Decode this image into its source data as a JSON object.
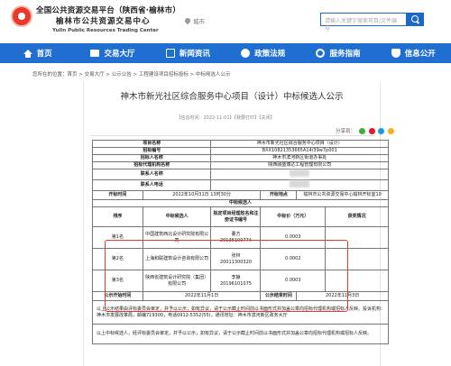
{
  "header": {
    "title_line1": "全国公共资源交易平台（陕西省·榆林市）",
    "title_line2": "榆林市公共资源交易中心",
    "title_en": "Yulin Public Resources Trading Center",
    "location": "城市",
    "search_placeholder": "请输入关键字搜索项目/文件编号"
  },
  "nav": {
    "items": [
      {
        "label": "首页",
        "icon": "home-icon"
      },
      {
        "label": "交易大厅",
        "icon": "trade-hall-icon"
      },
      {
        "label": "新闻资讯",
        "icon": "news-icon"
      },
      {
        "label": "政策法规",
        "icon": "policy-icon"
      },
      {
        "label": "服务指南",
        "icon": "service-icon"
      },
      {
        "label": "信息公开",
        "icon": "info-icon"
      }
    ]
  },
  "breadcrumb": "您所在的位置：首页 > 交易大厅 > 公示公告 > 工程建设项目招标投标 > 中标候选人公示",
  "doc": {
    "title": "神木市新光社区综合服务中心项目（设计）中标候选人公示",
    "meta": "【信息时间：2022-11-01】【我要打印】【关闭】",
    "share_label": "分享到：",
    "share_colors": [
      "#3cb035",
      "#e6162d",
      "#1a9be8",
      "#f2b21a"
    ]
  },
  "table": {
    "project_name_label": "项目名称",
    "project_name": "神木市新光社区综合服务中心项目（设计）",
    "tender_no_label": "招标编号",
    "tender_no": "BXX10821353665A14/39w7p001",
    "tenderer_label": "招标人名称",
    "tenderer": "神木市滨河新区街道办事处",
    "agency_label": "招标代理机构名称",
    "agency": "陕西融盛博达工程管理有限公司",
    "contact_label": "联系人名称",
    "phone_label": "联系人电话",
    "open_time_label": "开标时间",
    "open_time": "2022年10月31日 13时30分",
    "open_place_label": "开标地点",
    "open_place": "榆林市公共资源交易中心榆林开标室10",
    "candidates_title": "中标候选人",
    "col_rank": "排序",
    "col_name": "中标候选人",
    "col_pm": "拟定项目经理姓名和注册证书编号",
    "col_price": "中标价（万元）",
    "col_award": "获奖情况",
    "candidates": [
      {
        "rank": "第1名",
        "name": "中国建筑西北设计研究院有限公司",
        "pm_name": "董方",
        "pm_cert": "20136100774",
        "price": "0.0003"
      },
      {
        "rank": "第2名",
        "name": "上海和联建筑设计咨询有限公司",
        "pm_name": "张林",
        "pm_cert": "20011300320",
        "price": "0.0002"
      },
      {
        "rank": "第3名",
        "name": "陕西省建筑设计研究院（集团）有限公司",
        "pm_name": "李静",
        "pm_cert": "20196101075",
        "price": "0.0003"
      }
    ],
    "pub_start_label": "公示开始时间",
    "pub_start": "2022年11月1日",
    "pub_end_label": "公示结束时间",
    "pub_end": "2022年11月3日",
    "note1": "以上公示结果由评标委员会审定，并予以公示；如有异议，请于公示截止时间前以书面形式并加盖公章向招标代理机构或招标人反映。投诉机构：神木市发展改革局，邮编719300，电话0912-5352(55)，通讯地址：神木市滨河新区政务大厅",
    "note2": "以上中标候选人，经评标委员会审定，并予以公示；如有异议，请于公示截止时间前以书面形式并加盖公章向招标代理机构或招标人反映。"
  }
}
